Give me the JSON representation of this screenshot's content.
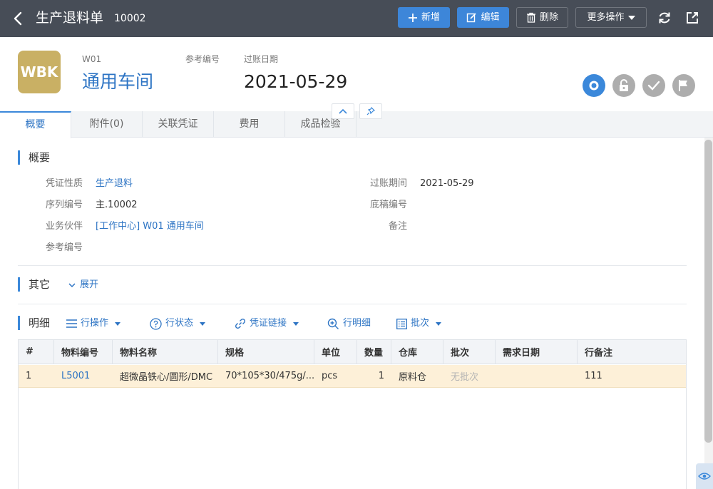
{
  "topbar": {
    "title": "生产退料单",
    "doc_no": "10002",
    "buttons": {
      "add": "新增",
      "edit": "编辑",
      "delete": "删除",
      "more": "更多操作"
    }
  },
  "header": {
    "logo_text": "WBK",
    "code": "W01",
    "name": "通用车间",
    "ref_label": "参考编号",
    "date_label": "过账日期",
    "date": "2021-05-29"
  },
  "tabs": [
    {
      "label": "概要",
      "active": true
    },
    {
      "label": "附件(0)"
    },
    {
      "label": "关联凭证"
    },
    {
      "label": "费用"
    },
    {
      "label": "成品检验"
    }
  ],
  "summary": {
    "title": "概要",
    "voucher_type_label": "凭证性质",
    "voucher_type": "生产退料",
    "serial_label": "序列编号",
    "serial": "主.10002",
    "partner_label": "业务伙伴",
    "partner": "[工作中心] W01 通用车间",
    "ref_label": "参考编号",
    "period_label": "过账期间",
    "period": "2021-05-29",
    "draft_label": "底稿编号",
    "remark_label": "备注"
  },
  "other": {
    "title": "其它",
    "expand": "展开"
  },
  "detail": {
    "title": "明细",
    "tools": {
      "row_ops": "行操作",
      "row_status": "行状态",
      "voucher_link": "凭证链接",
      "row_detail": "行明细",
      "batch": "批次"
    },
    "columns": [
      "#",
      "物料编号",
      "物料名称",
      "规格",
      "单位",
      "数量",
      "仓库",
      "批次",
      "需求日期",
      "行备注"
    ],
    "rows": [
      {
        "no": "1",
        "code": "L5001",
        "name": "超微晶铁心/圆形/DMC",
        "spec": "70*105*30/475g/...",
        "unit": "pcs",
        "qty": "1",
        "warehouse": "原料仓",
        "batch": "无批次",
        "need_date": "",
        "remark": "111"
      }
    ]
  },
  "colors": {
    "topbar": "#474d57",
    "accent": "#3b88da",
    "link": "#2d74c4",
    "logo": "#c9b064",
    "selected_row": "#fdf0d8"
  }
}
